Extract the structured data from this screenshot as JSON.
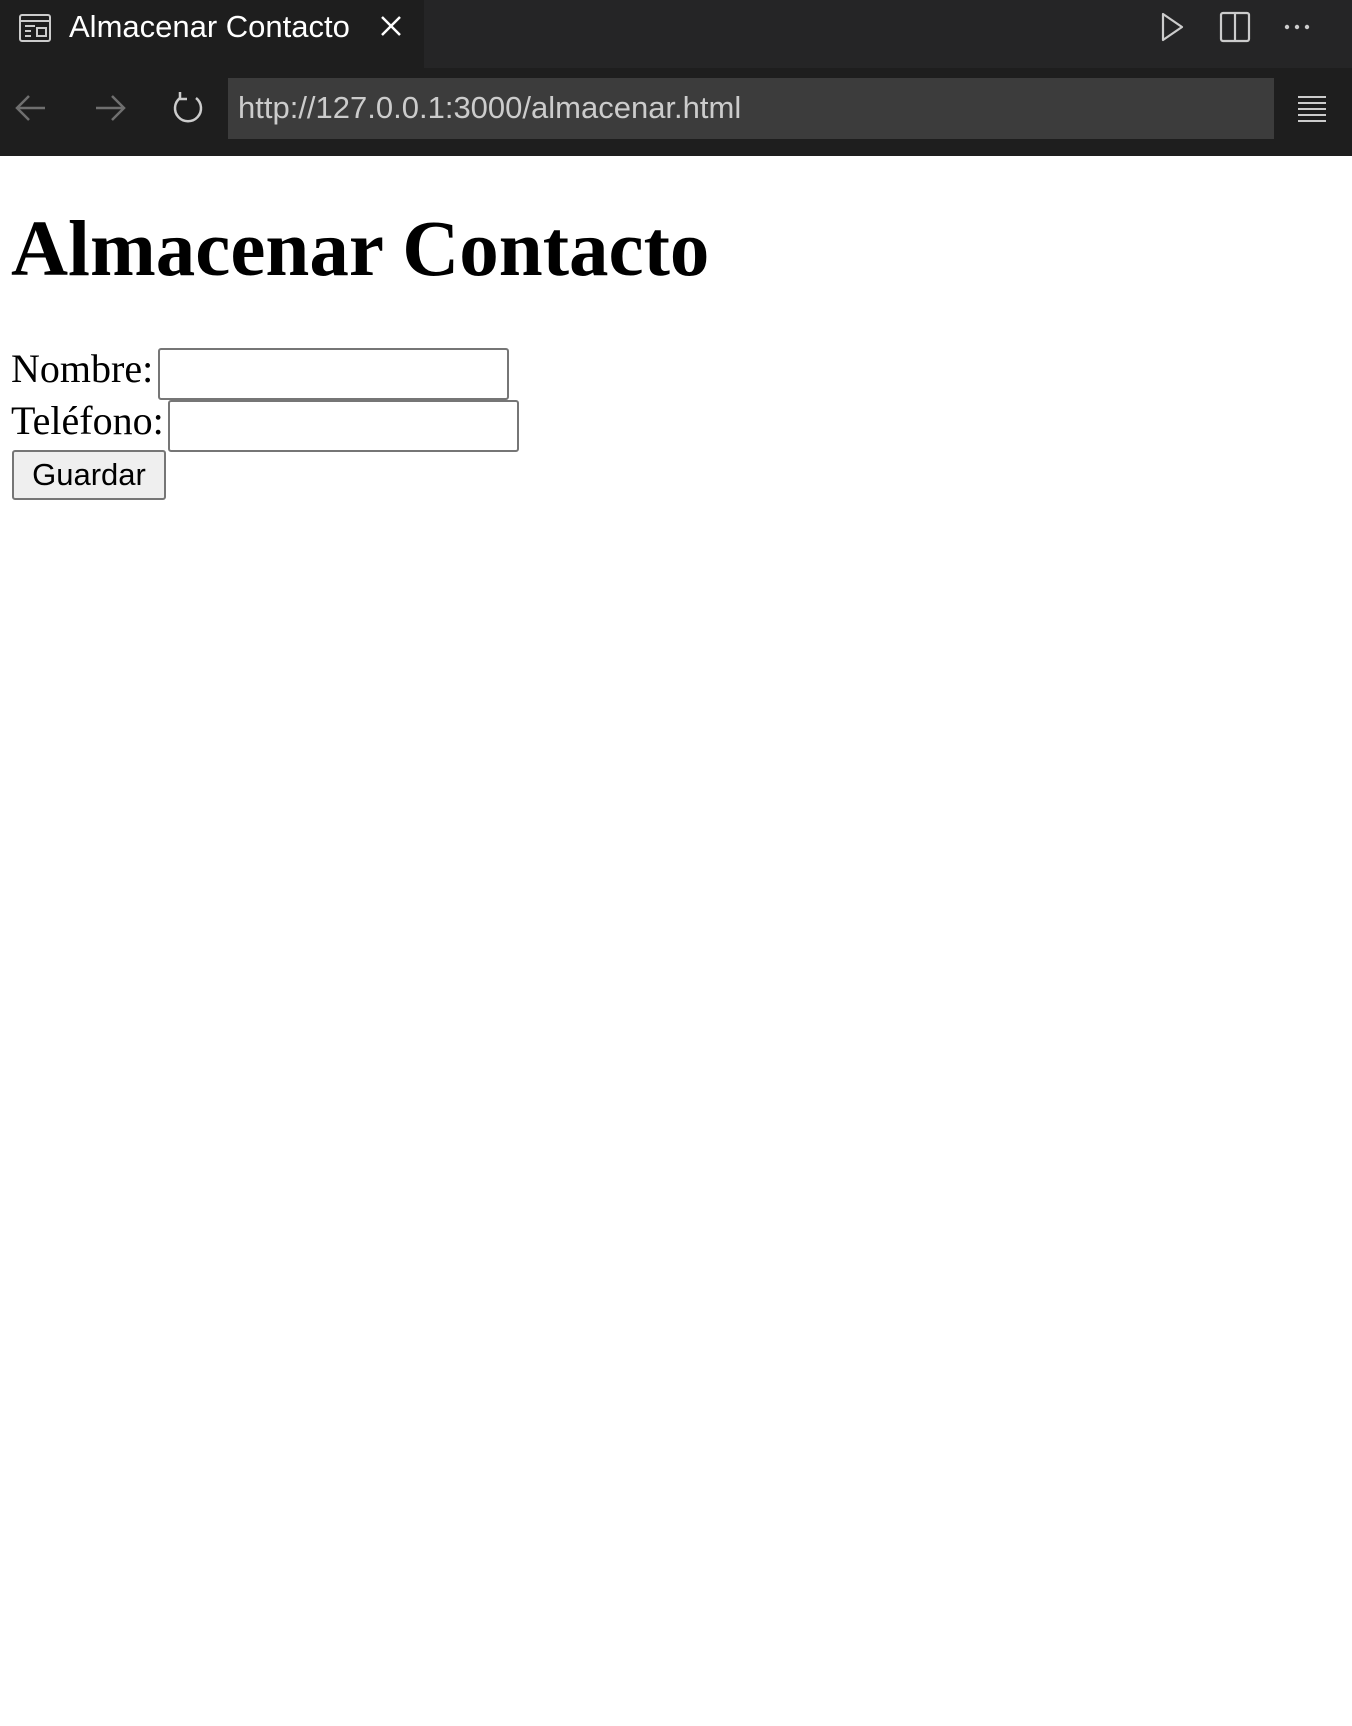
{
  "tab": {
    "title": "Almacenar Contacto",
    "icon": "preview-icon",
    "close_icon": "close-icon"
  },
  "tab_actions": {
    "run_icon": "play-icon",
    "split_icon": "split-editor-icon",
    "more_icon": "more-icon"
  },
  "navigation": {
    "back_icon": "arrow-left-icon",
    "forward_icon": "arrow-right-icon",
    "reload_icon": "reload-icon",
    "url": "http://127.0.0.1:3000/almacenar.html",
    "menu_icon": "menu-icon"
  },
  "page": {
    "heading": "Almacenar Contacto",
    "form": {
      "nombre_label": "Nombre:",
      "nombre_value": "",
      "telefono_label": "Teléfono:",
      "telefono_value": "",
      "submit_label": "Guardar"
    }
  },
  "colors": {
    "tabbar_bg": "#252526",
    "active_tab_bg": "#1e1e1e",
    "url_box_bg": "#3c3c3c",
    "page_bg": "#ffffff"
  }
}
